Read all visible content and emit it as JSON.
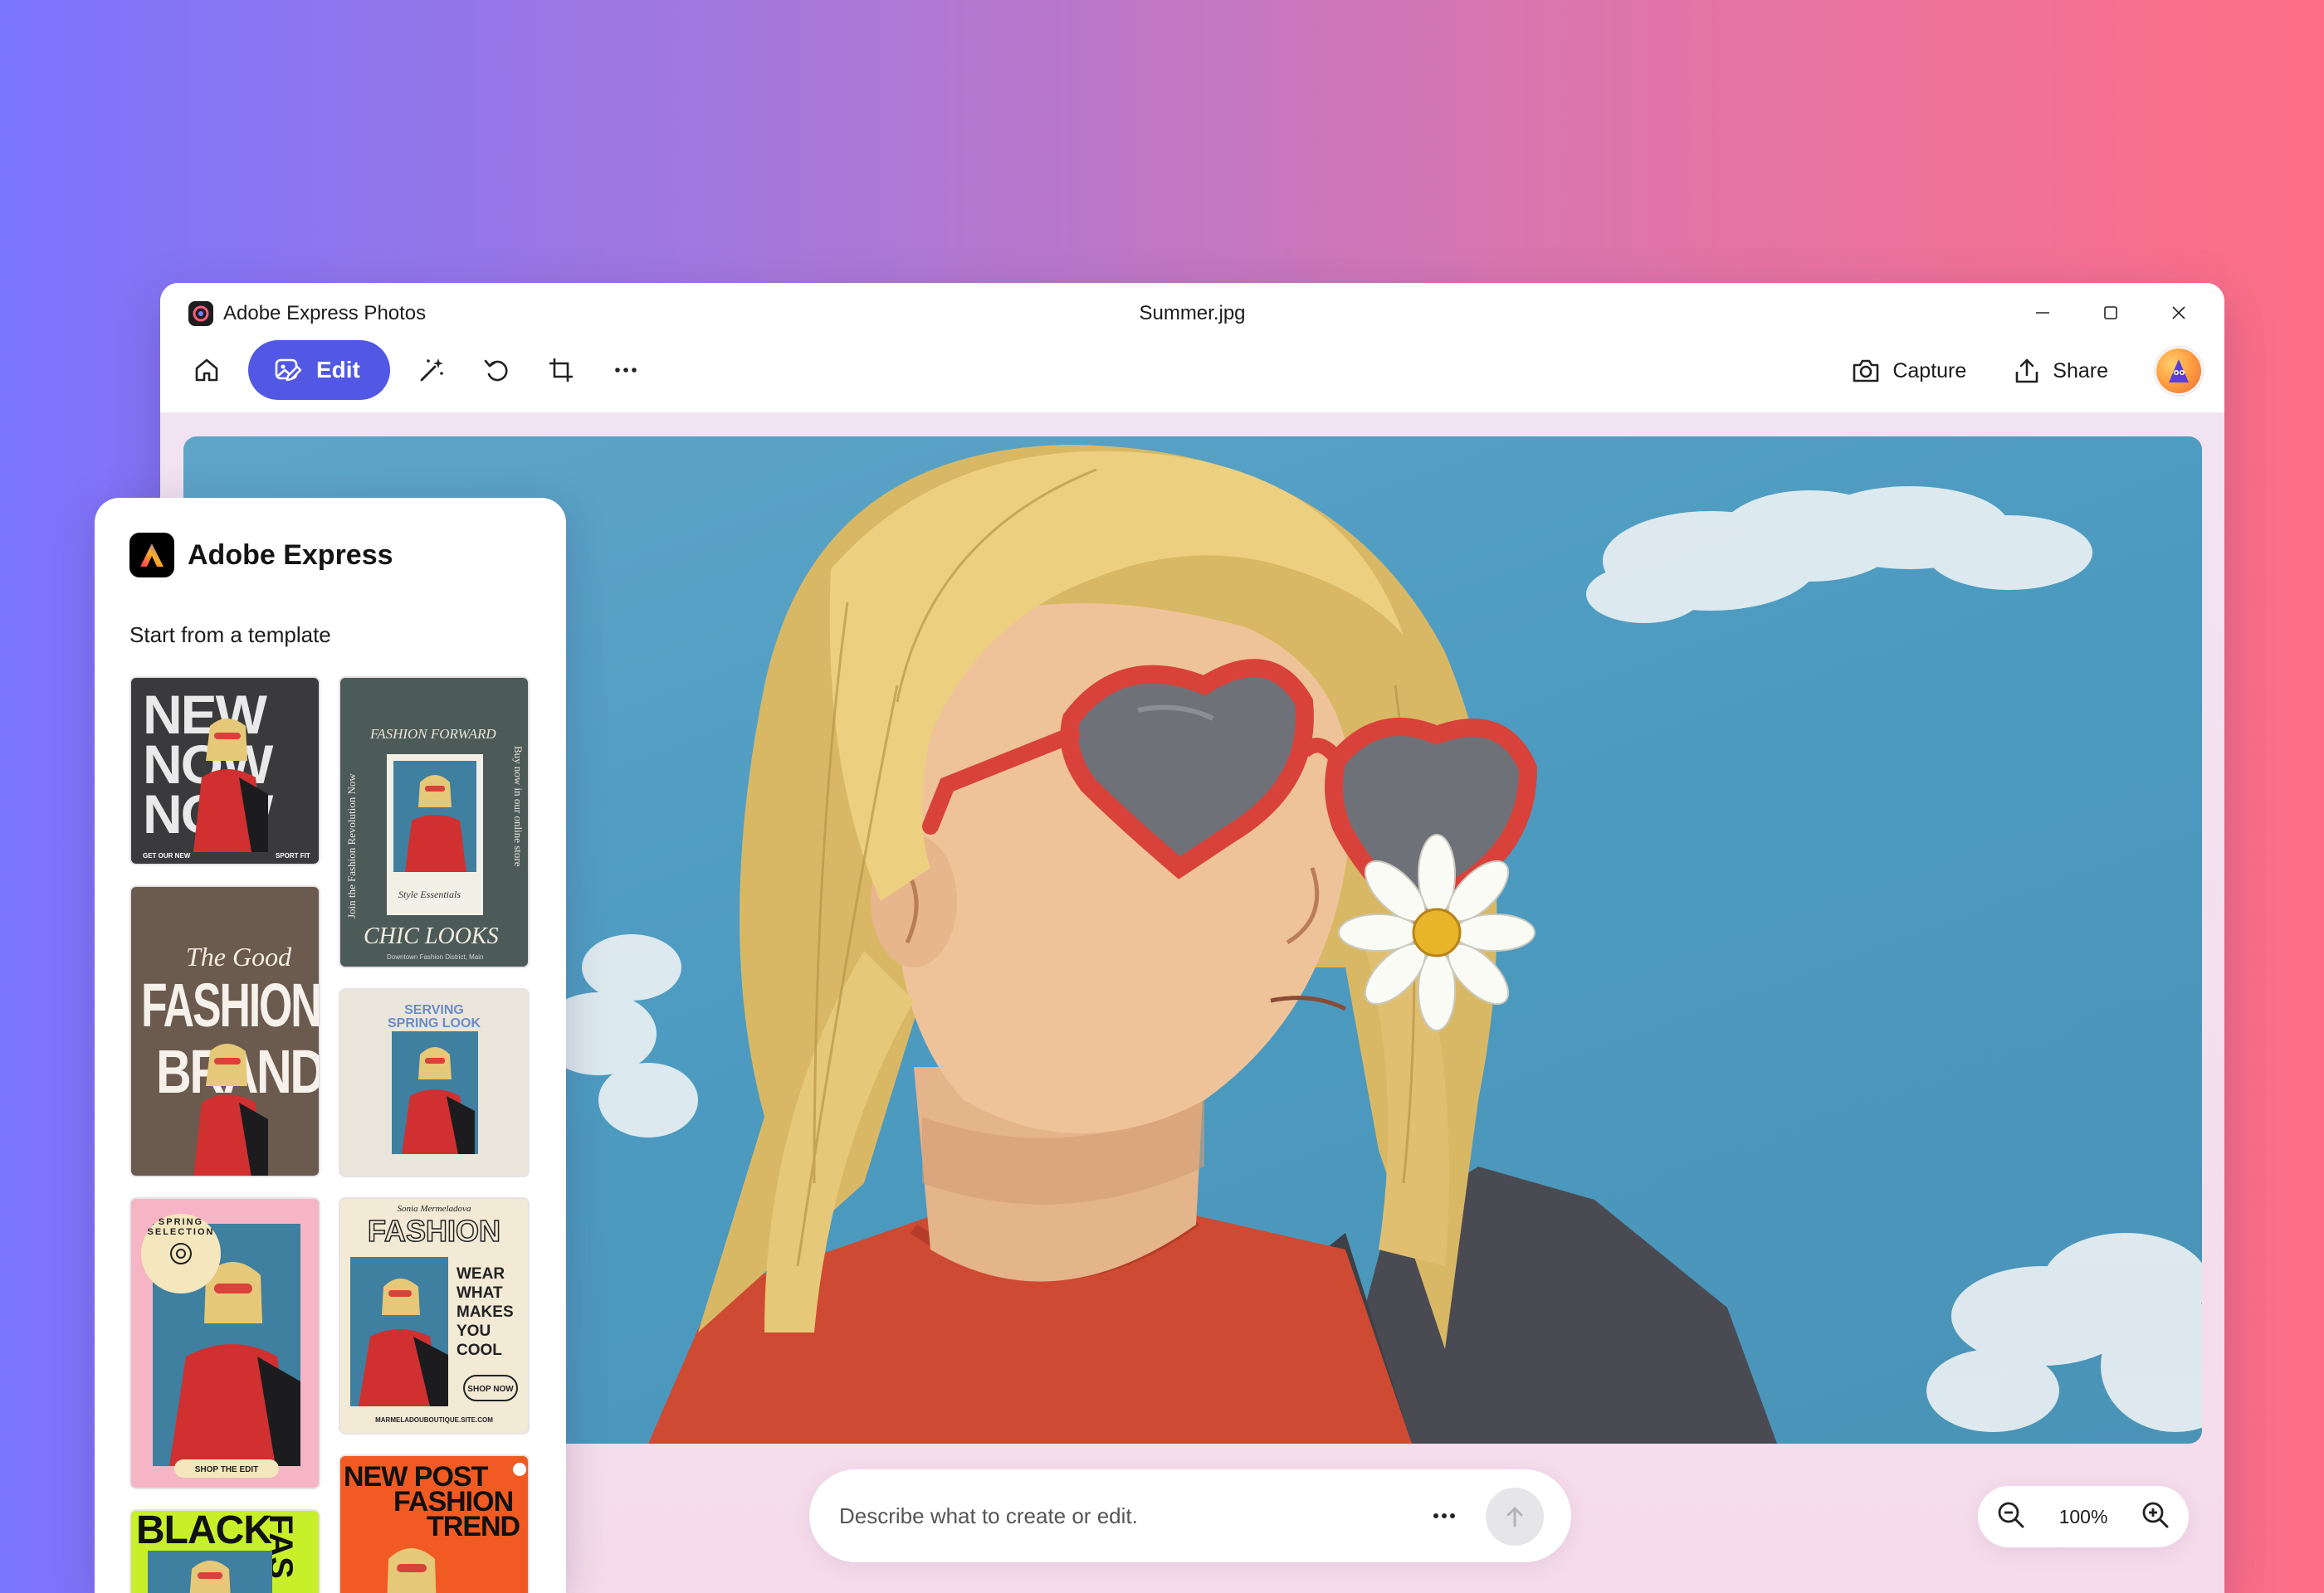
{
  "window": {
    "app_title": "Adobe Express Photos",
    "file_name": "Summer.jpg"
  },
  "toolbar": {
    "edit_label": "Edit",
    "capture_label": "Capture",
    "share_label": "Share"
  },
  "prompt": {
    "placeholder": "Describe what to create or edit."
  },
  "zoom": {
    "level": "100%"
  },
  "panel": {
    "title": "Adobe Express",
    "subtitle": "Start from a template",
    "templates": [
      {
        "lines": [
          "NEW",
          "NOW",
          "NOW"
        ],
        "footer_left": "GET OUR NEW",
        "footer_right": "SPORT FIT"
      },
      {
        "top": "FASHION FORWARD",
        "side_left": "Join the Fashion Revolution Now",
        "side_right": "Buy now in our online store",
        "script": "Style Essentials",
        "bottom": "CHIC LOOKS",
        "small": "Downtown Fashion District, Main"
      },
      {
        "script": "The Good",
        "line1": "FASHION",
        "line2": "BRAND"
      },
      {
        "line1": "SERVING",
        "line2": "SPRING LOOK"
      },
      {
        "badge": "SPRING SELECTION",
        "footer": "SHOP THE EDIT"
      },
      {
        "script": "Sonia Mermeladova",
        "title": "FASHION",
        "lines": [
          "WEAR",
          "WHAT",
          "MAKES",
          "YOU",
          "COOL"
        ],
        "button": "SHOP NOW",
        "footer": "MARMELADOUBOUTIQUE.SITE.COM"
      },
      {
        "line1": "BLACK",
        "line2": "FAS"
      },
      {
        "line1": "NEW POST",
        "line2": "FASHION",
        "line3": "TREND"
      }
    ]
  },
  "colors": {
    "accent": "#5258e4",
    "sky": "#4d9bc1",
    "sunglasses": "#d8423a",
    "hair": "#e6c879"
  }
}
